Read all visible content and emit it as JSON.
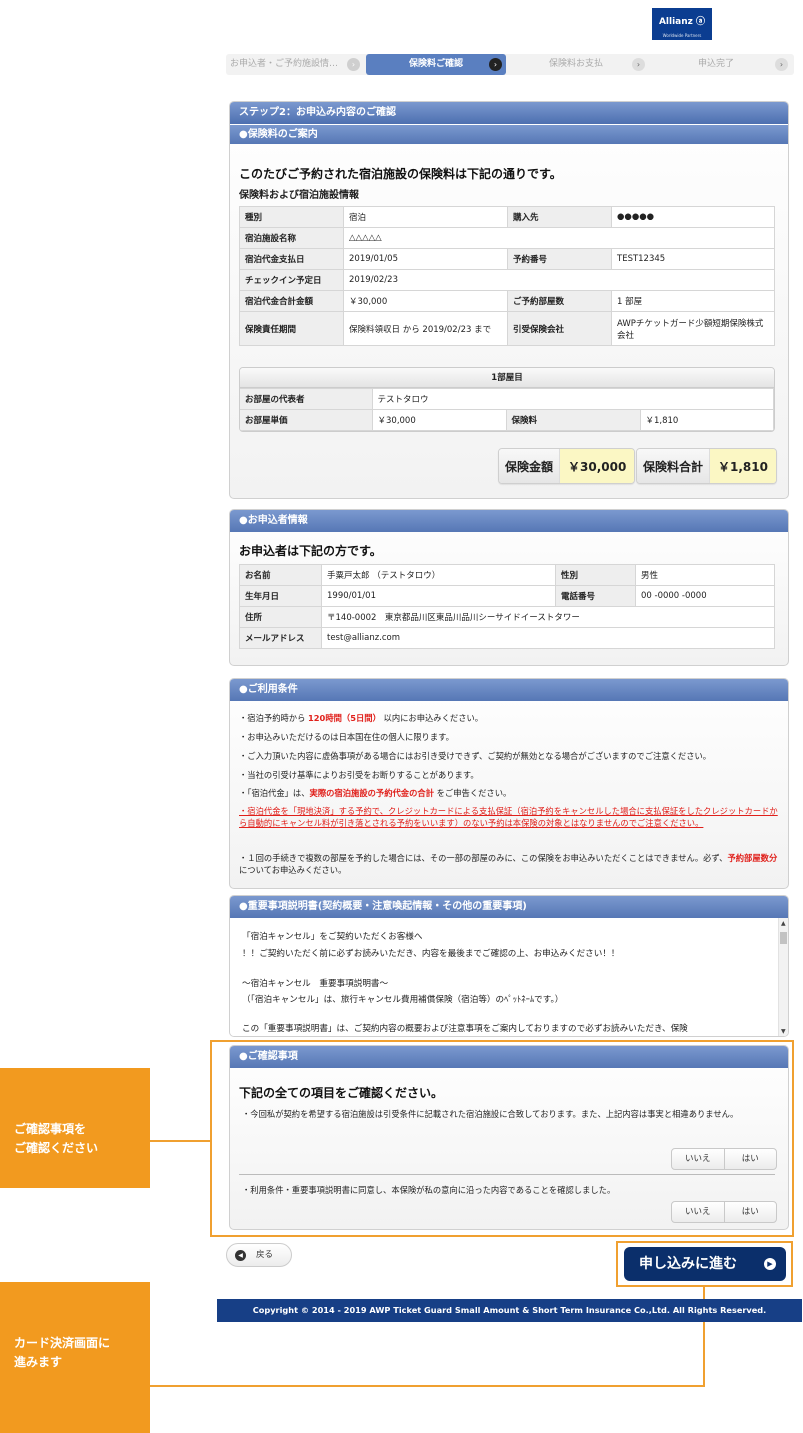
{
  "logo": {
    "name": "Allianz",
    "symbol": "ⓐ",
    "tagline": "Worldwide Partners"
  },
  "steps": [
    "お申込者・ご予約施設情…",
    "保険料ご確認",
    "保険料お支払",
    "申込完了"
  ],
  "step_arrow_icon": "›",
  "page_title": "ステップ2：お申込み内容のご確認",
  "premium": {
    "header": "●保険料のご案内",
    "lead": "このたびご予約された宿泊施設の保険料は下記の通りです。",
    "sub": "保険料および宿泊施設情報",
    "rows": [
      {
        "k1": "種別",
        "v1": "宿泊",
        "k2": "購入先",
        "v2": "●●●●●"
      },
      {
        "k1": "宿泊施設名称",
        "v1": "△△△△△"
      },
      {
        "k1": "宿泊代金支払日",
        "v1": "2019/01/05",
        "k2": "予約番号",
        "v2": "TEST12345"
      },
      {
        "k1": "チェックイン予定日",
        "v1": "2019/02/23"
      },
      {
        "k1": "宿泊代金合計金額",
        "v1": "￥30,000",
        "k2": "ご予約部屋数",
        "v2": "1 部屋"
      },
      {
        "k1": "保険責任期間",
        "v1": "保険料領収日 から 2019/02/23 まで",
        "k2": "引受保険会社",
        "v2": "AWPチケットガード少額短期保険株式会社"
      }
    ],
    "room": {
      "title": "1部屋目",
      "rep_label": "お部屋の代表者",
      "rep_value": "テストタロウ",
      "price_label": "お部屋単価",
      "price_value": "￥30,000",
      "fee_label": "保険料",
      "fee_value": "￥1,810"
    },
    "insured_label": "保険金額",
    "insured_value": "￥30,000",
    "total_label": "保険料合計",
    "total_value": "￥1,810"
  },
  "applicant": {
    "header": "●お申込者情報",
    "lead": "お申込者は下記の方です。",
    "name_label": "お名前",
    "name_value": "手粟戸太郎 （テストタロウ）",
    "gender_label": "性別",
    "gender_value": "男性",
    "birth_label": "生年月日",
    "birth_value": "1990/01/01",
    "phone_label": "電話番号",
    "phone_value": "00 -0000 -0000",
    "address_label": "住所",
    "address_value": "〒140-0002　東京都品川区東品川品川シーサイドイーストタワー",
    "email_label": "メールアドレス",
    "email_value": "test@allianz.com"
  },
  "terms": {
    "header": "●ご利用条件",
    "t1a": "・宿泊予約時から ",
    "t1b": "120時間（5日間）",
    "t1c": " 以内にお申込みください。",
    "t2": "・お申込みいただけるのは日本国在住の個人に限ります。",
    "t3": "・ご入力頂いた内容に虚偽事項がある場合にはお引き受けできず、ご契約が無効となる場合がございますのでご注意ください。",
    "t4": "・当社の引受け基準によりお引受をお断りすることがあります。",
    "t5a": "・「宿泊代金」は、",
    "t5b": "実際の宿泊施設の予約代金の合計",
    "t5c": " をご申告ください。",
    "t6": "・宿泊代金を「現地決済」する予約で、クレジットカードによる支払保証（宿泊予約をキャンセルした場合に支払保証をしたクレジットカードから自動的にキャンセル料が引き落とされる予約をいいます）のない予約は本保険の対象とはなりませんのでご注意ください。",
    "t7a": "・１回の手続きで複数の部屋を予約した場合には、その一部の部屋のみに、この保険をお申込みいただくことはできません。必ず、",
    "t7b": "予約部屋数分",
    "t7c": " についてお申込みください。"
  },
  "important": {
    "header": "●重要事項説明書(契約概要・注意喚起情報・その他の重要事項)",
    "lines": [
      "「宿泊キャンセル」をご契約いただくお客様へ",
      "！！ご契約いただく前に必ずお読みいただき、内容を最後までご確認の上、お申込みください！！",
      "～宿泊キャンセル　重要事項説明書～",
      "（「宿泊キャンセル」は、旅行キャンセル費用補償保険（宿泊等）のﾍﾟｯﾄﾈｰﾑです。）",
      "この「重要事項説明書」は、ご契約内容の概要および注意事項をご案内しておりますので必ずお読みいただき、保険"
    ]
  },
  "confirm": {
    "header": "●ご確認事項",
    "lead": "下記の全ての項目をご確認ください。",
    "q1": "・今回私が契約を希望する宿泊施設は引受条件に記載された宿泊施設に合致しております。また、上記内容は事実と相違ありません。",
    "q2": "・利用条件・重要事項説明書に同意し、本保険が私の意向に沿った内容であることを確認しました。",
    "no": "いいえ",
    "yes": "はい"
  },
  "annotations": {
    "confirm_note": "ご確認事項を\nご確認ください",
    "proceed_note": "カード決済画面に\n進みます"
  },
  "actions": {
    "back": "戻る",
    "back_icon": "◀",
    "proceed": "申し込みに進む",
    "proceed_icon": "▶"
  },
  "footer": "Copyright © 2014 - 2019 AWP Ticket Guard Small Amount & Short Term Insurance Co.,Ltd. All Rights Reserved.",
  "colors": {
    "accent": "#4d6fb0",
    "dark_navy": "#0b2f6b",
    "footer": "#173f86",
    "annotation_orange": "#f29a1f",
    "warning_red": "#e0201b",
    "highlight_yellow": "#fbf7c4"
  }
}
